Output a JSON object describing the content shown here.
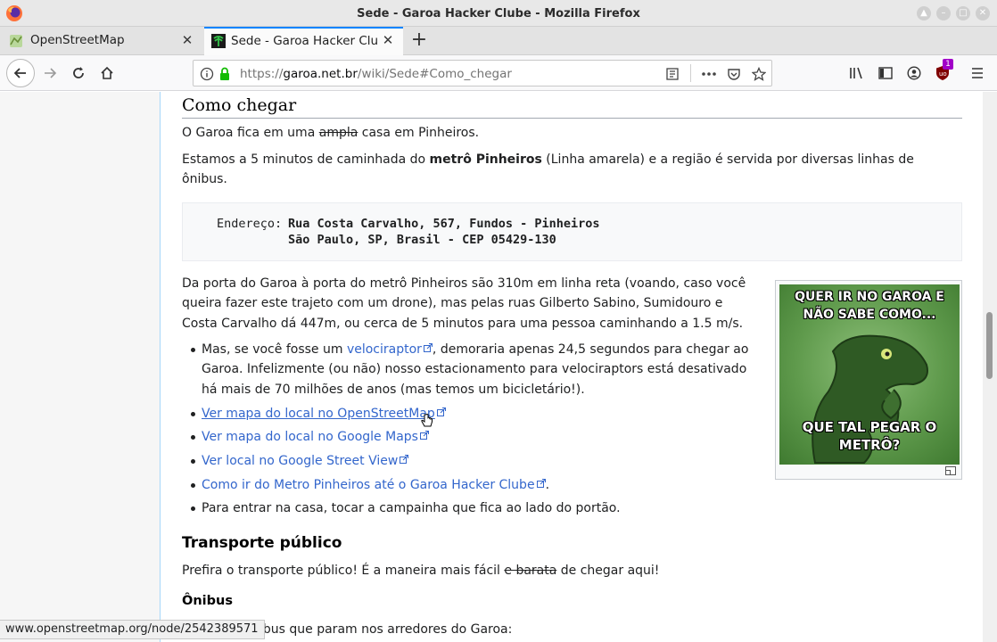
{
  "window": {
    "title": "Sede - Garoa Hacker Clube - Mozilla Firefox",
    "controls": [
      "up-icon",
      "minimize-icon",
      "maximize-icon",
      "close-icon"
    ]
  },
  "tabs": [
    {
      "label": "OpenStreetMap",
      "active": false,
      "icon": "osm-favicon"
    },
    {
      "label": "Sede - Garoa Hacker Clube",
      "active": true,
      "icon": "garoa-favicon"
    }
  ],
  "toolbar": {
    "url_prefix": "https://",
    "url_host": "garoa.net.br",
    "url_path": "/wiki/Sede#Como_chegar",
    "badge_count": "1",
    "accent": "#0a84ff"
  },
  "article": {
    "section_title": "Como chegar",
    "p1_before": "O Garoa fica em uma ",
    "p1_strike": "ampla",
    "p1_after": " casa em Pinheiros.",
    "p2_before": "Estamos a 5 minutos de caminhada do ",
    "p2_bold": "metrô Pinheiros",
    "p2_after": " (Linha amarela) e a região é servida por diversas linhas de",
    "p2_line2": "ônibus.",
    "address_label": "Endereço:",
    "address_line1": "Rua Costa Carvalho, 567, Fundos - Pinheiros",
    "address_line2": "São Paulo, SP, Brasil - CEP 05429-130",
    "p3_line1": "Da porta do Garoa à porta do metrô Pinheiros são 310m em linha reta (voando, caso você",
    "p3_line2": "queira fazer este trajeto com um drone), mas pelas ruas Gilberto Sabino, Sumidouro e",
    "p3_line3": "Costa Carvalho dá 447m, ou cerca de 5 minutos para uma pessoa caminhando a 1.5 m/s.",
    "b1_before": "Mas, se você fosse um ",
    "b1_link": "velociraptor",
    "b1_after": ", demoraria apenas 24,5 segundos para chegar ao",
    "b1_line2": "Garoa. Infelizmente (ou não) nosso estacionamento para velociraptors está desativado",
    "b1_line3": "há mais de 70 milhões de anos (mas temos um bicicletário!).",
    "b2_link": "Ver mapa do local no OpenStreetMap",
    "b3_link": "Ver mapa do local no Google Maps",
    "b4_link": "Ver local no Google Street View",
    "b5_link": "Como ir do Metro Pinheiros até o Garoa Hacker Clube",
    "b5_after": ".",
    "b6": "Para entrar na casa, tocar a campainha que fica ao lado do portão.",
    "meme_top": "QUER IR NO GAROA E NÃO SABE COMO...",
    "meme_bottom": "QUE TAL PEGAR O METRÔ?",
    "h_transport": "Transporte público",
    "p4_before": "Prefira o transporte público! É a maneira mais fácil ",
    "p4_strike": "e barata",
    "p4_after": " de chegar aqui!",
    "h_bus": "Ônibus",
    "p5_visible": "ibus que param nos arredores do Garoa:"
  },
  "status_bar": {
    "text": "www.openstreetmap.org/node/2542389571"
  }
}
